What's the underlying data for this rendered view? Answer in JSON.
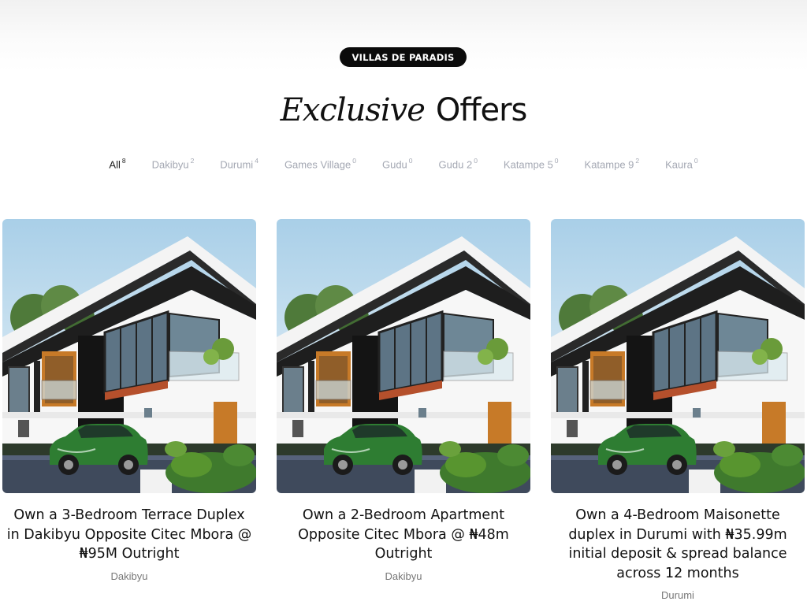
{
  "header": {
    "badge": "VILLAS DE PARADIS",
    "title_italic": "Exclusive",
    "title_bold": "Offers"
  },
  "filters": [
    {
      "label": "All",
      "count": "8",
      "active": true
    },
    {
      "label": "Dakibyu",
      "count": "2"
    },
    {
      "label": "Durumi",
      "count": "4"
    },
    {
      "label": "Games Village",
      "count": "0"
    },
    {
      "label": "Gudu",
      "count": "0"
    },
    {
      "label": "Gudu 2",
      "count": "0"
    },
    {
      "label": "Katampe 5",
      "count": "0"
    },
    {
      "label": "Katampe 9",
      "count": "2"
    },
    {
      "label": "Kaura",
      "count": "0"
    }
  ],
  "offers": [
    {
      "title": "Own a 3-Bedroom Terrace Duplex in Dakibyu Opposite Citec Mbora @ ₦95M Outright",
      "location": "Dakibyu"
    },
    {
      "title": "Own a 2-Bedroom Apartment Opposite Citec Mbora @ ₦48m Outright",
      "location": "Dakibyu"
    },
    {
      "title": "Own a 4-Bedroom Maisonette duplex in Durumi with ₦35.99m initial deposit & spread balance across 12 months",
      "location": "Durumi"
    }
  ],
  "colors": {
    "badge_bg": "#0b0b0b",
    "filter_inactive": "#a4a8b3",
    "filter_active": "#222222",
    "car": "#2e7d32"
  },
  "icons": {
    "property_image": "house-render-image"
  }
}
